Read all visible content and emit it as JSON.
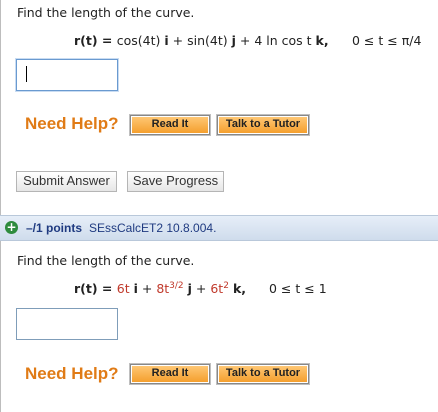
{
  "problem1": {
    "prompt": "Find the length of the curve.",
    "formula": {
      "lhs": "r(t) = ",
      "term1": "cos(4t)",
      "i": "i",
      "plus1": " + ",
      "term2": "sin(4t)",
      "j": "j",
      "plus2": " + ",
      "coef3": "4",
      "term3": " ln cos t",
      "k": "k,",
      "range_pre": "0 ≤ t ≤ ",
      "range_upper": "π/4"
    },
    "answer_value": "",
    "need_help": "Need Help?",
    "read_it": "Read It",
    "talk_tutor": "Talk to a Tutor",
    "submit": "Submit Answer",
    "save": "Save Progress"
  },
  "question2_header": {
    "expand_icon": "plus-circle-icon",
    "points": "–/1 points",
    "id": "SEssCalcET2 10.8.004."
  },
  "problem2": {
    "prompt": "Find the length of the curve.",
    "formula": {
      "lhs": "r(t) = ",
      "coef1": "6t",
      "i": "i",
      "plus1": " + ",
      "coef2": "8t",
      "exp2": "3/2",
      "j": "j",
      "plus2": " + ",
      "coef3": "6t",
      "exp3": "2",
      "k": "k,",
      "range": "0 ≤ t ≤ 1"
    },
    "answer_value": "",
    "need_help": "Need Help?",
    "read_it": "Read It",
    "talk_tutor": "Talk to a Tutor"
  },
  "colors": {
    "need_help": "#e07b16",
    "help_button": "#f7a83a",
    "red_value": "#c0392b",
    "header_bg": "#d8e3f0",
    "points_text": "#1f3a80"
  }
}
